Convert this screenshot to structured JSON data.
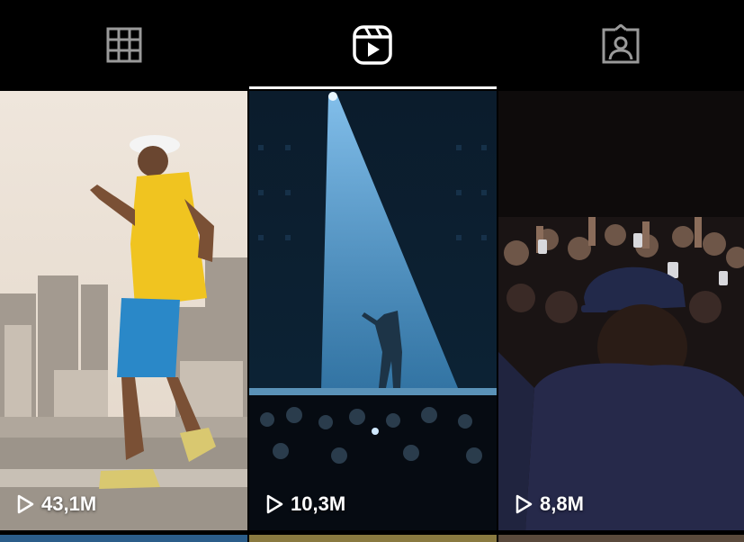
{
  "tabs": [
    {
      "name": "grid-icon",
      "active": false
    },
    {
      "name": "reels-icon",
      "active": true
    },
    {
      "name": "tagged-icon",
      "active": false
    }
  ],
  "reels": [
    {
      "views": "43,1M"
    },
    {
      "views": "10,3M"
    },
    {
      "views": "8,8M"
    }
  ],
  "colors": {
    "background": "#000000",
    "active_tab": "#ffffff",
    "inactive_icon": "#9a9a9a"
  }
}
